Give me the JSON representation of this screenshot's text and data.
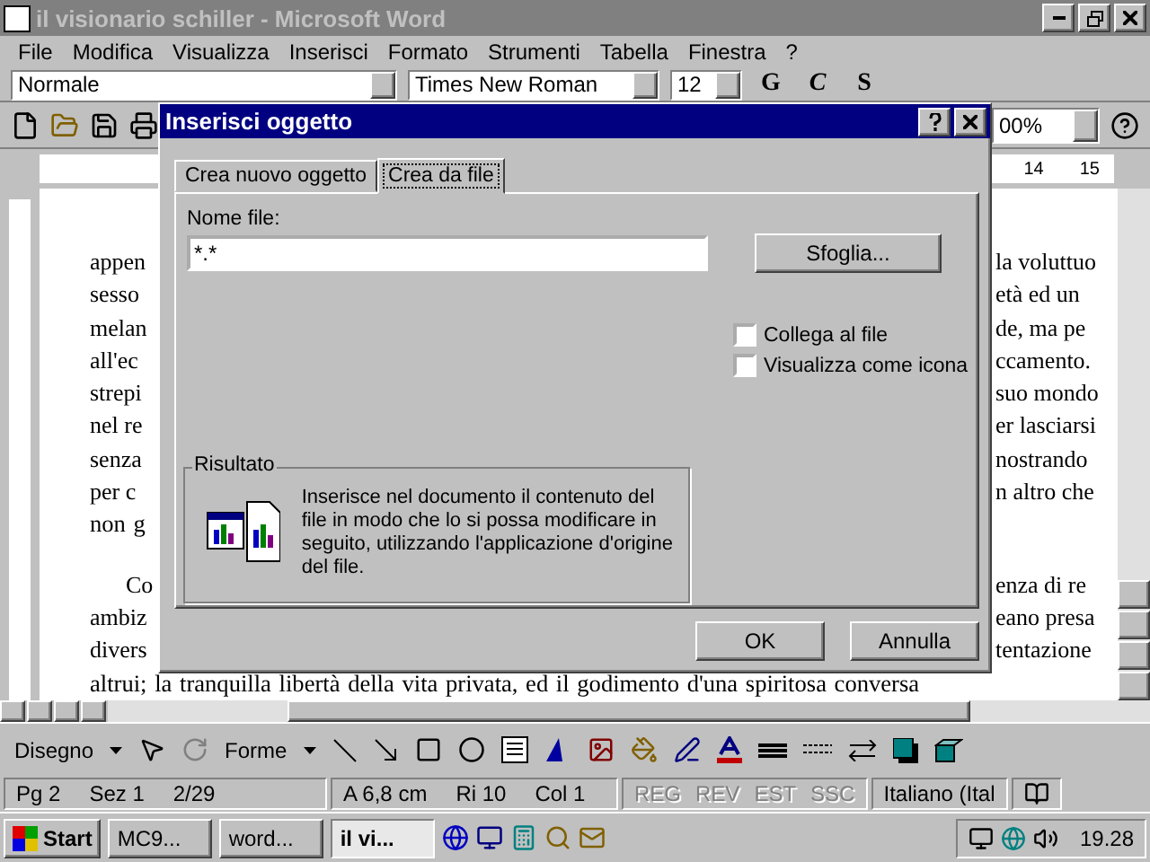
{
  "window": {
    "title": "il visionario schiller - Microsoft Word"
  },
  "menu": [
    "File",
    "Modifica",
    "Visualizza",
    "Inserisci",
    "Formato",
    "Strumenti",
    "Tabella",
    "Finestra",
    "?"
  ],
  "formatting_toolbar": {
    "style": "Normale",
    "font": "Times New Roman",
    "size": "12",
    "bold": "G",
    "italic": "C",
    "underline": "S"
  },
  "standard_toolbar": {
    "zoom": "00%"
  },
  "ruler": {
    "labels": [
      "14",
      "15"
    ]
  },
  "document": {
    "paragraphs": [
      {
        "lines": [
          {
            "left": "appen",
            "right": "la voluttuo"
          },
          {
            "left": "sesso",
            "right": "età ed un"
          },
          {
            "left": "melan",
            "right": "de, ma pe"
          },
          {
            "left": "all'ec",
            "right": "ccamento."
          },
          {
            "left": "strepi",
            "right": "suo mondo"
          },
          {
            "left": "nel re",
            "right": "er lasciarsi"
          },
          {
            "left": "senza",
            "right": "nostrando"
          },
          {
            "left": "per c",
            "right": "n altro che"
          },
          {
            "left": "non g"
          }
        ]
      },
      {
        "lines": [
          {
            "left": "Co",
            "right": "enza di re",
            "indent": true
          },
          {
            "left": "ambiz",
            "right": "eano presa"
          },
          {
            "left": "divers",
            "right": "tentazione"
          },
          {
            "left": "altrui; la tranquilla libertà della vita privata, ed il godimento d'una spiritosa conversa"
          }
        ]
      }
    ]
  },
  "dialog": {
    "title": "Inserisci oggetto",
    "tabs": [
      {
        "label": "Crea nuovo oggetto",
        "selected": false
      },
      {
        "label": "Crea da file",
        "selected": true
      }
    ],
    "file_label": "Nome file:",
    "file_value": "*.*",
    "browse": "Sfoglia...",
    "checkboxes": [
      {
        "label": "Collega al file",
        "checked": false
      },
      {
        "label": "Visualizza come icona",
        "checked": false
      }
    ],
    "result": {
      "title": "Risultato",
      "text": "Inserisce nel documento il contenuto del file in modo che lo si possa modificare in seguito, utilizzando l'applicazione d'origine del file."
    },
    "buttons": [
      "OK",
      "Annulla"
    ]
  },
  "drawing_toolbar": {
    "draw": "Disegno",
    "shapes": "Forme"
  },
  "status_bar": {
    "fields": [
      {
        "text": "Pg 2",
        "kind": "plain"
      },
      {
        "text": "Sez 1",
        "kind": "plain"
      },
      {
        "text": "2/29",
        "kind": "plain"
      },
      {
        "text": "A 6,8 cm",
        "kind": "plain"
      },
      {
        "text": "Ri 10",
        "kind": "plain"
      },
      {
        "text": "Col 1",
        "kind": "plain"
      },
      {
        "text": "REG",
        "kind": "mode",
        "disabled": true
      },
      {
        "text": "REV",
        "kind": "mode",
        "disabled": true
      },
      {
        "text": "EST",
        "kind": "mode",
        "disabled": true
      },
      {
        "text": "SSC",
        "kind": "mode",
        "disabled": true
      },
      {
        "text": "Italiano (Ital",
        "kind": "plain"
      }
    ]
  },
  "taskbar": {
    "start": "Start",
    "tasks": [
      {
        "label": "MC9...",
        "selected": false
      },
      {
        "label": "word...",
        "selected": false
      },
      {
        "label": "il vi...",
        "selected": true
      }
    ],
    "clock": "19.28"
  }
}
